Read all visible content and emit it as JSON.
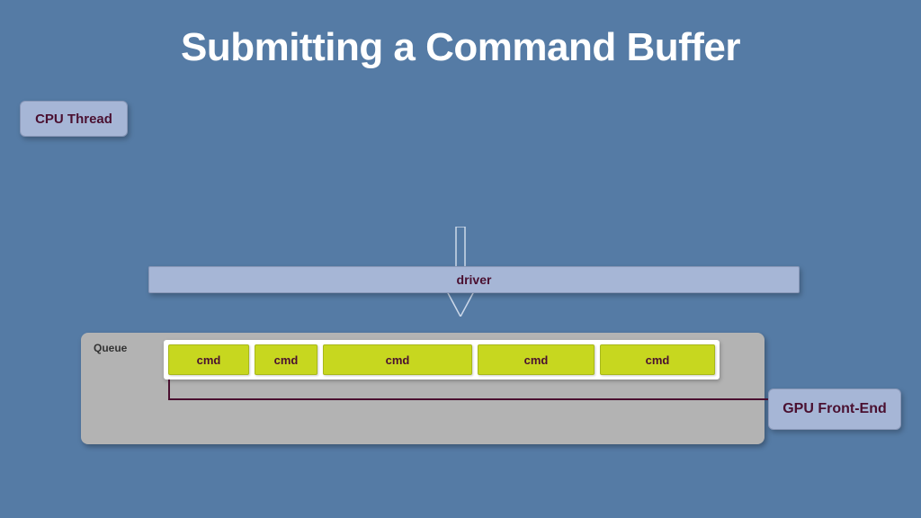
{
  "title": "Submitting a Command Buffer",
  "cpu_thread": {
    "label": "CPU Thread"
  },
  "driver": {
    "label": "driver"
  },
  "queue": {
    "label": "Queue",
    "commands": [
      "cmd",
      "cmd",
      "cmd",
      "cmd",
      "cmd"
    ]
  },
  "gpu": {
    "label": "GPU Front-End"
  },
  "colors": {
    "background": "#557ba5",
    "box_fill": "#a6b6d6",
    "cmd_fill": "#c7d71f",
    "text_dark": "#4a1030",
    "queue_panel": "#b3b3b3"
  }
}
